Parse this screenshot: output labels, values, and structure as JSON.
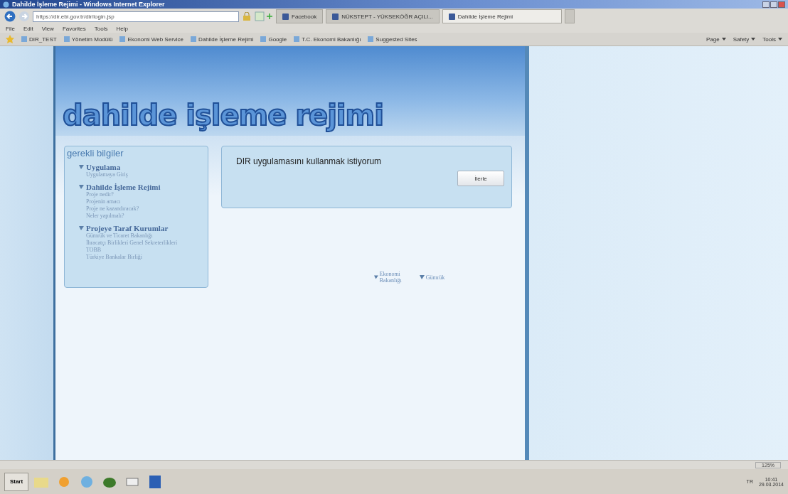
{
  "window": {
    "title": "Dahilde İşleme Rejimi - Windows Internet Explorer"
  },
  "address_bar": {
    "value": "https://dir.ebi.gov.tr/dir/login.jsp"
  },
  "browser_tabs": [
    {
      "label": "Facebook",
      "selected": false
    },
    {
      "label": "NÜKSTEPT - YÜKSEKÖĞR AÇILI...",
      "selected": false
    },
    {
      "label": "Dahilde İşleme Rejimi",
      "selected": true
    }
  ],
  "menu": [
    "File",
    "Edit",
    "View",
    "Favorites",
    "Tools",
    "Help"
  ],
  "favorites": [
    "DIR_TEST",
    "Yönetim Modülü",
    "Ekonomi Web Service",
    "Dahilde İşleme Rejimi",
    "Google",
    "T.C. Ekonomi Bakanlığı",
    "Suggested Sites"
  ],
  "command_bar": [
    "Page",
    "Safety",
    "Tools"
  ],
  "site": {
    "logo": "dahilde işleme rejimi"
  },
  "sidebar": {
    "title": "gerekli bilgiler",
    "sections": [
      {
        "heading": "Uygulama",
        "links": [
          "Uygulamaya Giriş"
        ]
      },
      {
        "heading": "Dahilde İşleme Rejimi",
        "links": [
          "Proje nedir?",
          "Projenin amacı",
          "Proje ne kazandıracak?",
          "Neler yapılmalı?"
        ]
      },
      {
        "heading": "Projeye Taraf Kurumlar",
        "links": [
          "Gümrük ve Ticaret Bakanlığı",
          "İhracatçı Birlikleri Genel Sekreterlikleri",
          "TOBB",
          "Türkiye Bankalar Birliği"
        ]
      }
    ]
  },
  "main": {
    "message": "DIR uygulamasını kullanmak istiyorum",
    "button": "İlerle"
  },
  "footer_links": [
    "Ekonomi Bakanlığı",
    "Gümrük"
  ],
  "status_bar": {
    "zoom": "125%"
  },
  "taskbar": {
    "start": "Start",
    "language": "TR",
    "time": "10:41",
    "date": "29.03.2014"
  }
}
